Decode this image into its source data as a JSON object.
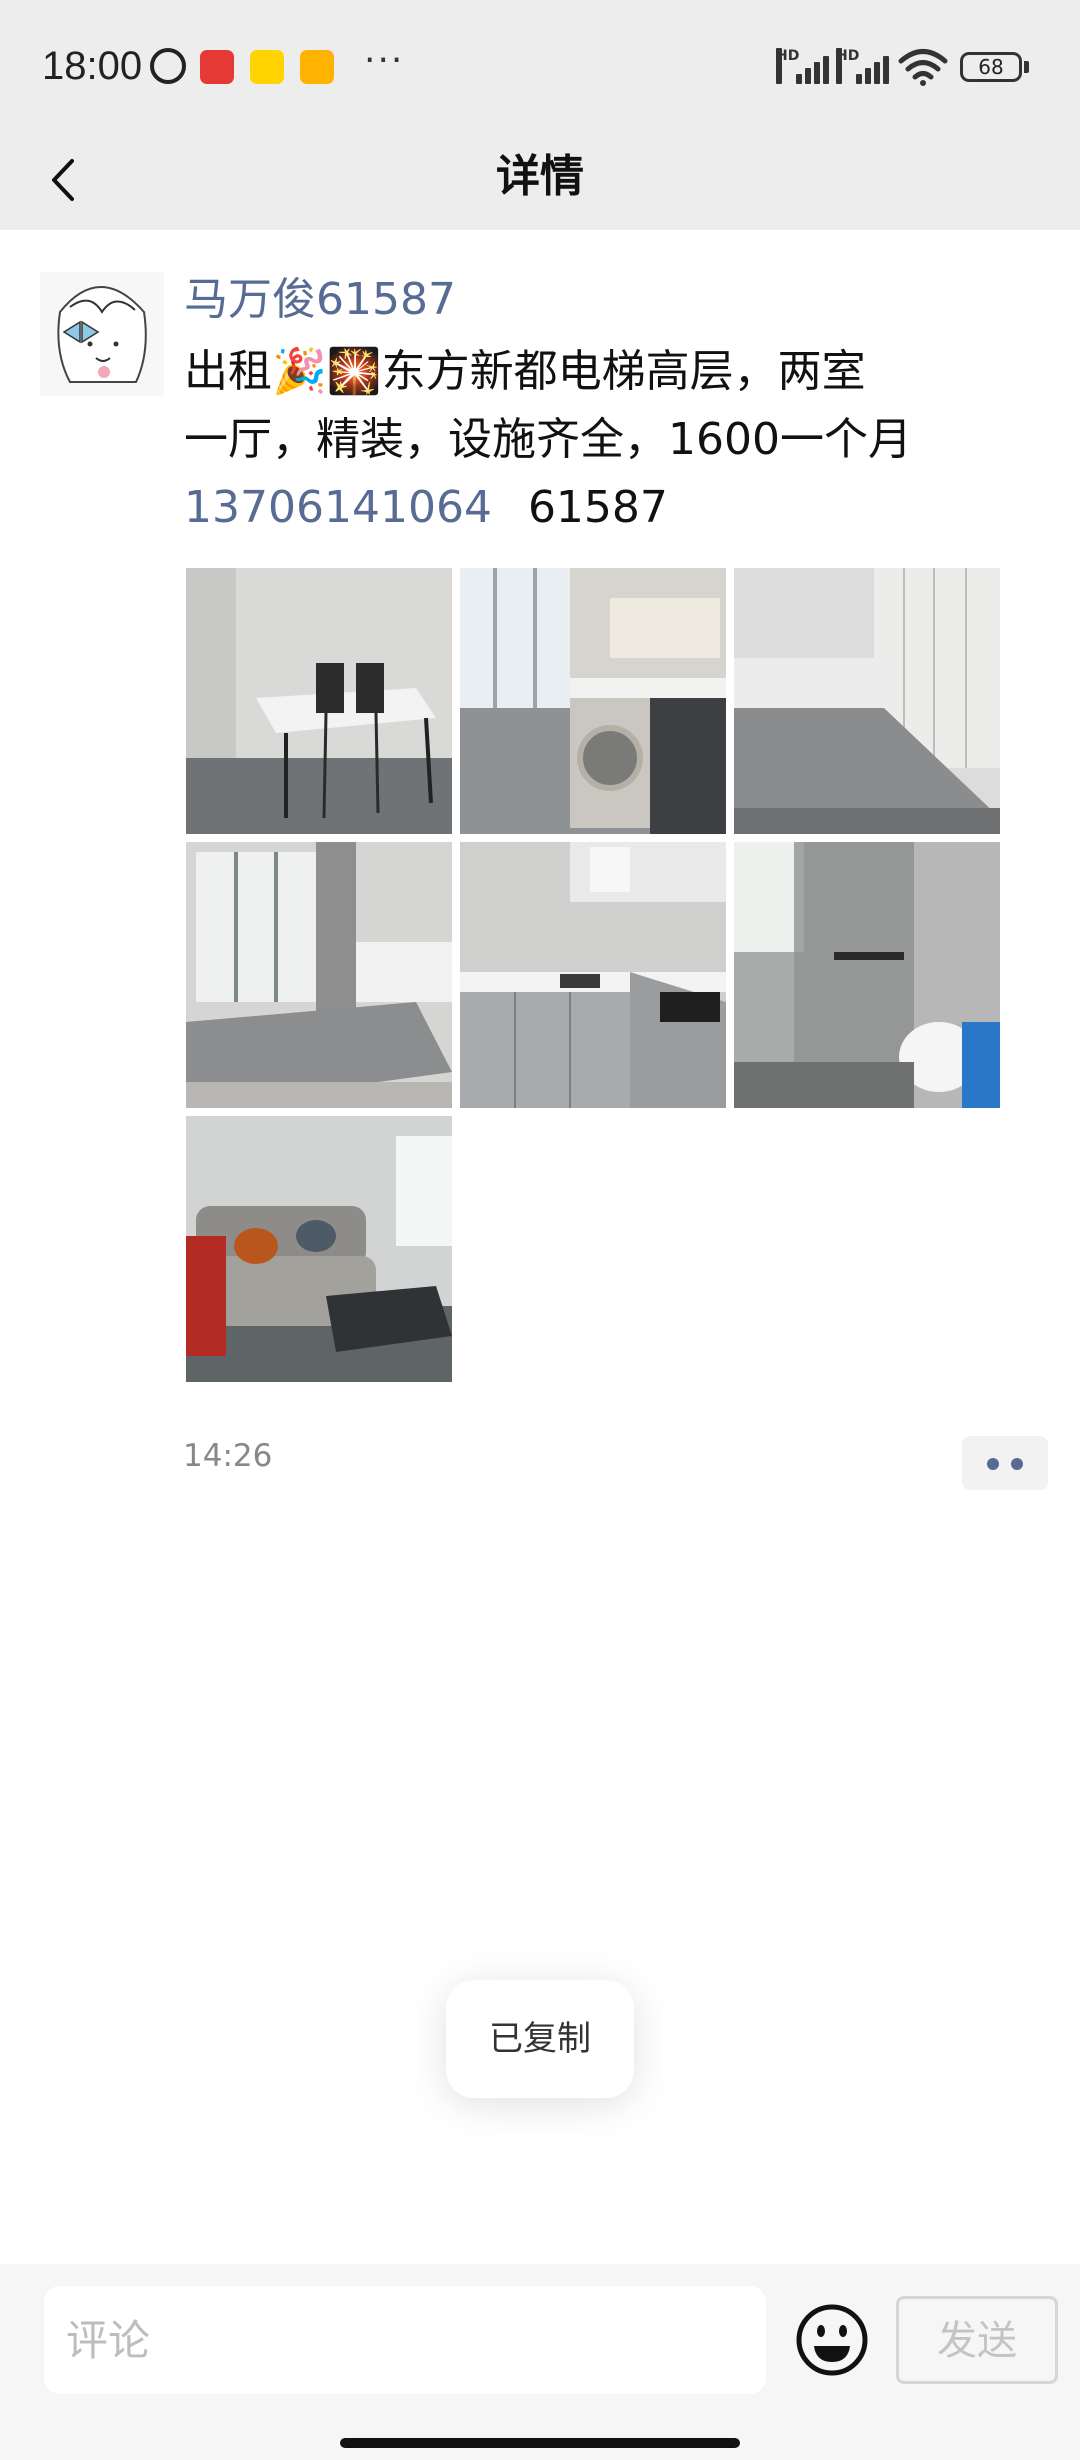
{
  "status_bar": {
    "time": "18:00",
    "battery": "68",
    "signal_label": "HD",
    "more": "···"
  },
  "header": {
    "title": "详情"
  },
  "post": {
    "author": "马万俊61587",
    "line1": "出租🎉🎇东方新都电梯高层，两室",
    "line2": "一厅，精装，设施齐全，1600一个月",
    "phone": "13706141064",
    "code": "61587",
    "photo_count": 7,
    "time": "14:26"
  },
  "toast": {
    "text": "已复制"
  },
  "bottom_bar": {
    "comment_placeholder": "评论",
    "send_label": "发送"
  },
  "colors": {
    "link": "#576b95",
    "header_bg": "#ededed",
    "bottom_bg": "#f6f6f6"
  }
}
